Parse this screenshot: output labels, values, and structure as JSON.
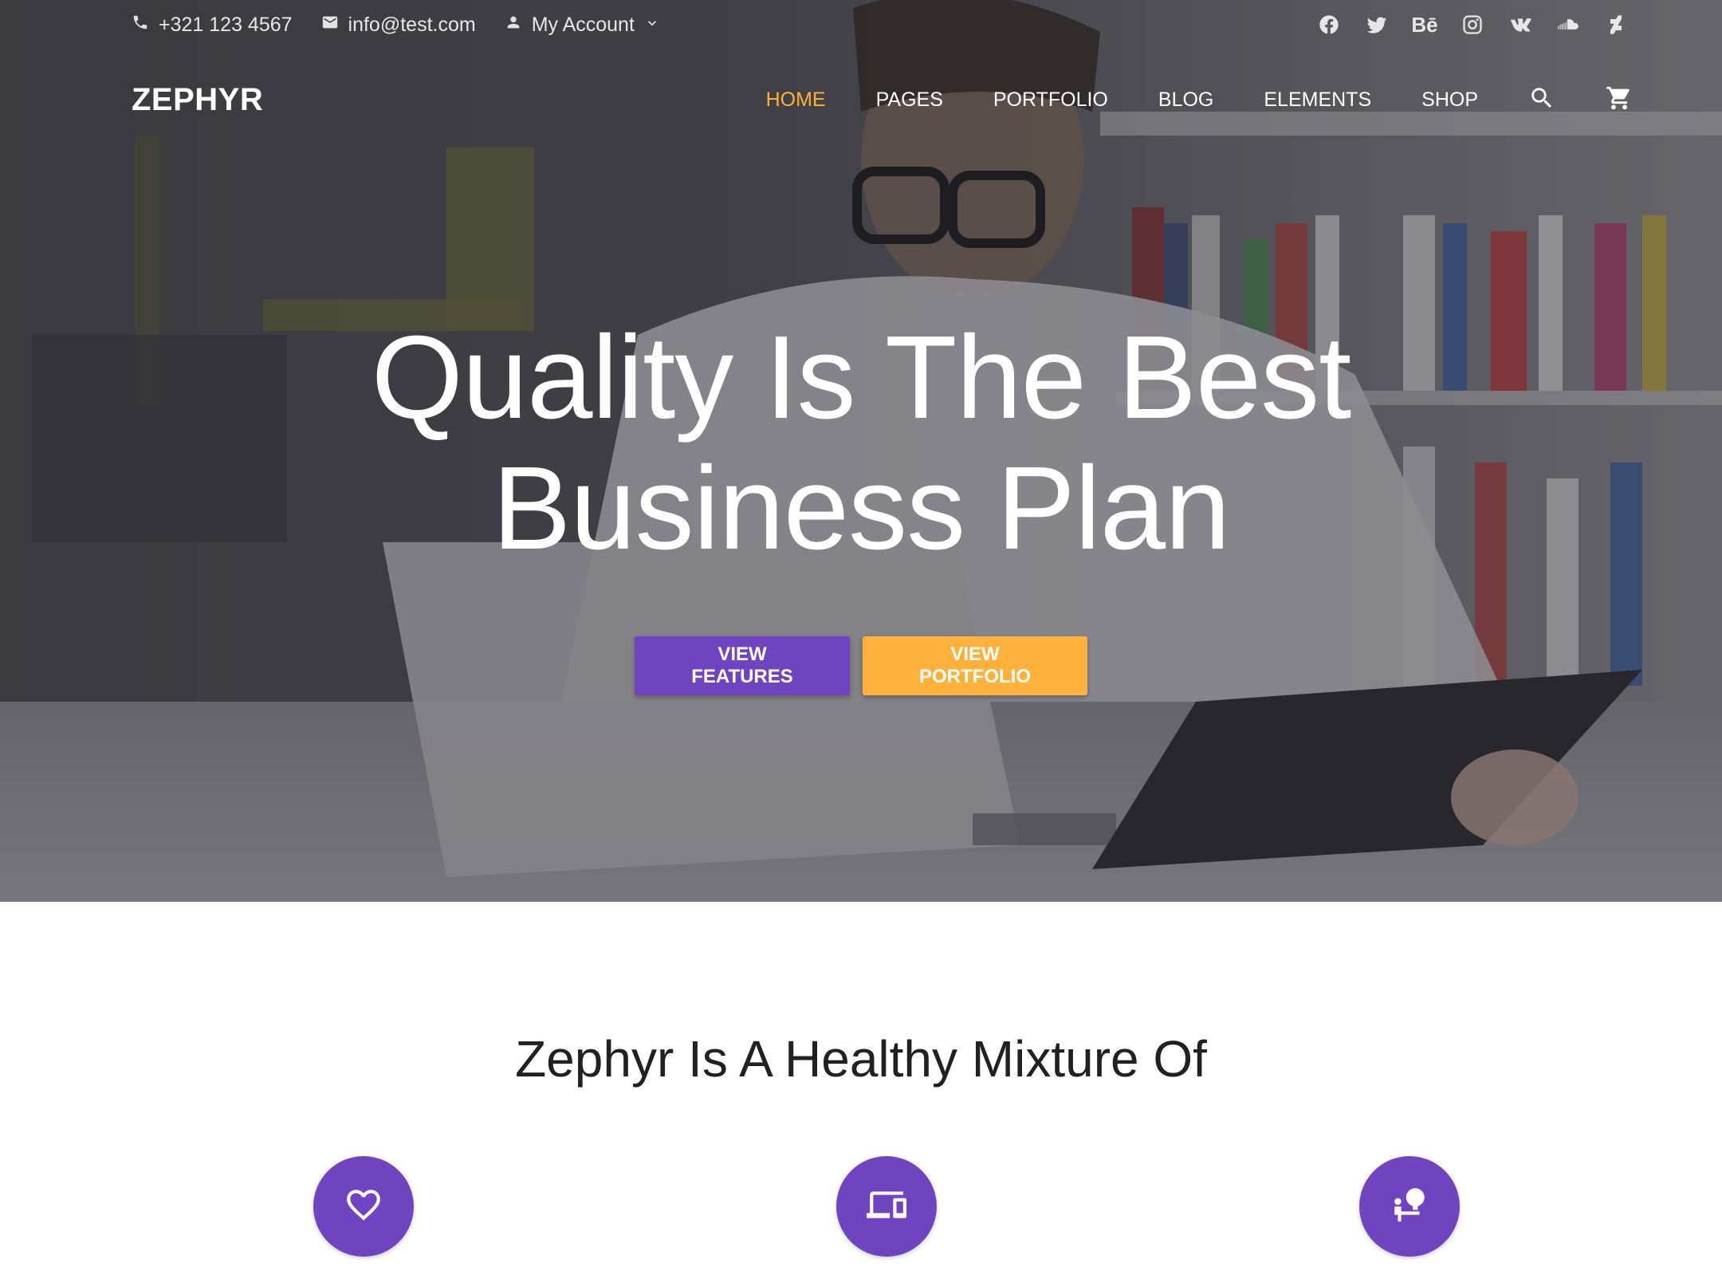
{
  "topbar": {
    "phone": "+321 123 4567",
    "email": "info@test.com",
    "account": "My Account",
    "socials": [
      "facebook-icon",
      "twitter-icon",
      "behance-icon",
      "instagram-icon",
      "vk-icon",
      "soundcloud-icon",
      "deviantart-icon"
    ],
    "behance_text": "Bē"
  },
  "navbar": {
    "logo": "ZEPHYR",
    "links": [
      {
        "label": "HOME",
        "active": true
      },
      {
        "label": "PAGES",
        "active": false
      },
      {
        "label": "PORTFOLIO",
        "active": false
      },
      {
        "label": "BLOG",
        "active": false
      },
      {
        "label": "ELEMENTS",
        "active": false
      },
      {
        "label": "SHOP",
        "active": false
      }
    ],
    "icons": [
      "search-icon",
      "cart-icon"
    ]
  },
  "hero": {
    "title_line1": "Quality Is The Best",
    "title_line2": "Business Plan",
    "btn_features": "VIEW FEATURES",
    "btn_portfolio": "VIEW PORTFOLIO"
  },
  "features": {
    "title": "Zephyr Is A Healthy Mixture Of",
    "icons": [
      "heart-icon",
      "devices-icon",
      "presenter-icon"
    ]
  },
  "colors": {
    "accent_purple": "#7043c0",
    "accent_orange": "#ffb13b",
    "nav_active": "#ffb13b"
  }
}
